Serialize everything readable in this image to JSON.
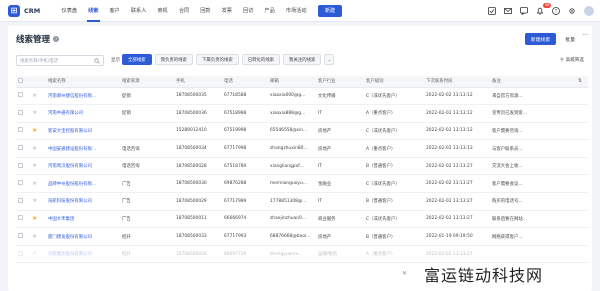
{
  "brand": {
    "name": "CRM",
    "logo_icon": "crm-logo-icon",
    "accent": "#2d5bd8"
  },
  "nav": {
    "items": [
      "仪表盘",
      "线索",
      "客户",
      "联系人",
      "商机",
      "合同",
      "回款",
      "发票",
      "回访",
      "产品",
      "市场活动"
    ],
    "active_index": 1,
    "new_button": "新建"
  },
  "topbar_right": {
    "notification_count": "48"
  },
  "page": {
    "title": "线索管理",
    "new_lead_button": "新建线索",
    "import_button": "批量",
    "more_button": "···"
  },
  "filters": {
    "search_placeholder": "线索名称/手机/电话",
    "show_label": "显示",
    "buttons": [
      "全部线索",
      "我负责的线索",
      "下属负责的线索",
      "已转化的线索",
      "我关注的线索"
    ],
    "active_index": 0,
    "advanced_filter": "高级筛选"
  },
  "table": {
    "headers": [
      "线索名称",
      "线索来源",
      "手机",
      "电话",
      "邮箱",
      "客户行业",
      "客户级别",
      "下次联系时间",
      "备注"
    ],
    "rows": [
      {
        "starred": false,
        "name": "河南郑州捷信股份有限...",
        "source": "促销",
        "mobile": "18708500035",
        "phone": "67718588",
        "email": "xiaoxia000@g...",
        "industry": "文化传媒",
        "level": "C（非优先客户）",
        "next_contact": "2022-02-02 13:13:12",
        "note": "来自官方资源..."
      },
      {
        "starred": false,
        "name": "河南中通有限公司",
        "source": "促销",
        "mobile": "18708500036",
        "phone": "67518988",
        "email": "xiaoxia888@g...",
        "industry": "IT",
        "level": "A（重点客户）",
        "next_contact": "2022-02-02 13:13:12",
        "note": "宣传页已发到客..."
      },
      {
        "starred": true,
        "name": "新安大宝控股有限公司",
        "source": "",
        "mobile": "15289012410",
        "phone": "67519998",
        "email": "65546558@sin...",
        "industry": "房地产",
        "level": "C（非优先客户）",
        "next_contact": "2022-02-02 13:13:12",
        "note": "客户需要咨询..."
      },
      {
        "starred": false,
        "name": "中国安通建设股份有限...",
        "source": "电话咨询",
        "mobile": "18708500034",
        "phone": "67717998",
        "email": "zhangzhuxin80...",
        "industry": "房地产",
        "level": "A（重点客户）",
        "next_contact": "2022-02-02 13:13:13",
        "note": "与客户联系员..."
      },
      {
        "starred": false,
        "name": "河南周汉股份有限公司",
        "source": "电话咨询",
        "mobile": "18708500028",
        "phone": "67518780",
        "email": "xiangliangpof...",
        "industry": "IT",
        "level": "B（普通客户）",
        "next_contact": "2022-02-02 13:13:27",
        "note": "交流大会上收..."
      },
      {
        "starred": false,
        "name": "品牌中州股份股份有限...",
        "source": "广告",
        "mobile": "18708500030",
        "phone": "69876288",
        "email": "meimianguoyu...",
        "industry": "金融业",
        "level": "C（非优先客户）",
        "next_contact": "2022-02-02 13:13:27",
        "note": "客户需要会议..."
      },
      {
        "starred": false,
        "name": "海航科技股份有限公司",
        "source": "广告",
        "mobile": "18708500029",
        "phone": "67717989",
        "email": "1778851308@...",
        "industry": "IT",
        "level": "B（普通客户）",
        "next_contact": "2022-02-02 13:13:27",
        "note": "购买的电话号..."
      },
      {
        "starred": true,
        "name": "中国大禾集团",
        "source": "广告",
        "mobile": "18708500011",
        "phone": "66666974",
        "email": "zhaojinzhuan0...",
        "industry": "商业服务",
        "level": "C（非优先客户）",
        "next_contact": "2022-02-02 13:13:27",
        "note": "联系后要在网站..."
      },
      {
        "starred": false,
        "name": "厦门建发股份有限公司",
        "source": "招开",
        "mobile": "18708500033",
        "phone": "67717993",
        "email": "68876668@baol...",
        "industry": "房地产",
        "level": "B（普通客户）",
        "next_contact": "2022-01-19 09:19:50",
        "note": "网络获得客户..."
      },
      {
        "starred": false,
        "name": "贝航集团股份有限公司",
        "source": "招开",
        "mobile": "18708500026",
        "phone": "66697729",
        "email": "zhengyuanm...",
        "industry": "运输/物流",
        "level": "A（重点客户）",
        "next_contact": "2022-02-02 13:13:27",
        "note": ""
      }
    ]
  },
  "watermark": "富运链动科技网"
}
